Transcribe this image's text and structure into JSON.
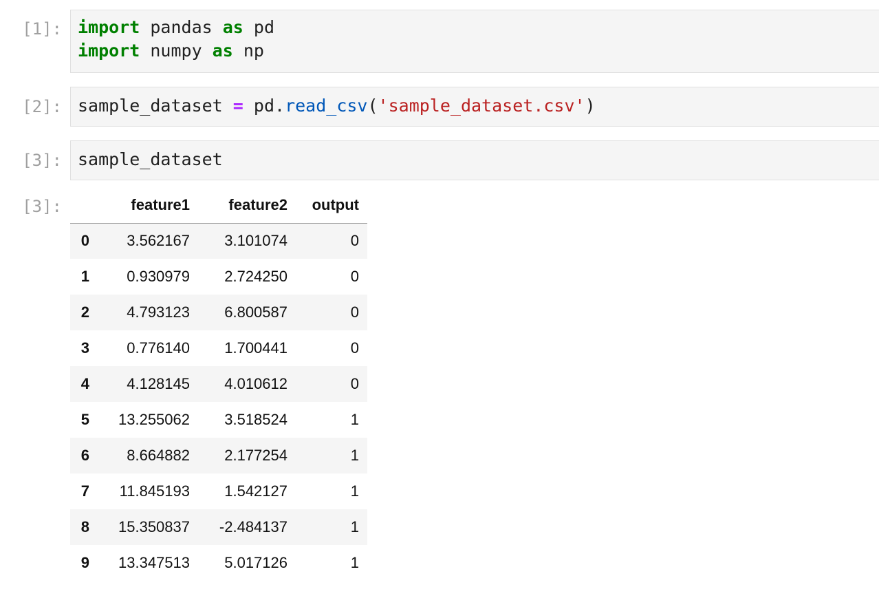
{
  "cells": [
    {
      "prompt": "[1]:",
      "lines": [
        [
          {
            "t": "import",
            "c": "kw"
          },
          {
            "t": " pandas ",
            "c": ""
          },
          {
            "t": "as",
            "c": "kw"
          },
          {
            "t": " pd",
            "c": ""
          }
        ],
        [
          {
            "t": "import",
            "c": "kw"
          },
          {
            "t": " numpy ",
            "c": ""
          },
          {
            "t": "as",
            "c": "kw"
          },
          {
            "t": " np",
            "c": ""
          }
        ]
      ]
    },
    {
      "prompt": "[2]:",
      "lines": [
        [
          {
            "t": "sample_dataset ",
            "c": ""
          },
          {
            "t": "=",
            "c": "op"
          },
          {
            "t": " pd.",
            "c": ""
          },
          {
            "t": "read_csv",
            "c": "fn"
          },
          {
            "t": "(",
            "c": ""
          },
          {
            "t": "'sample_dataset.csv'",
            "c": "str"
          },
          {
            "t": ")",
            "c": ""
          }
        ]
      ]
    },
    {
      "prompt": "[3]:",
      "lines": [
        [
          {
            "t": "sample_dataset",
            "c": ""
          }
        ]
      ]
    }
  ],
  "output": {
    "prompt": "[3]:",
    "columns": [
      "",
      "feature1",
      "feature2",
      "output"
    ],
    "rows": [
      [
        "0",
        "3.562167",
        "3.101074",
        "0"
      ],
      [
        "1",
        "0.930979",
        "2.724250",
        "0"
      ],
      [
        "2",
        "4.793123",
        "6.800587",
        "0"
      ],
      [
        "3",
        "0.776140",
        "1.700441",
        "0"
      ],
      [
        "4",
        "4.128145",
        "4.010612",
        "0"
      ],
      [
        "5",
        "13.255062",
        "3.518524",
        "1"
      ],
      [
        "6",
        "8.664882",
        "2.177254",
        "1"
      ],
      [
        "7",
        "11.845193",
        "1.542127",
        "1"
      ],
      [
        "8",
        "15.350837",
        "-2.484137",
        "1"
      ],
      [
        "9",
        "13.347513",
        "5.017126",
        "1"
      ]
    ]
  },
  "colors": {
    "keyword": "#008000",
    "operator": "#aa22ff",
    "function": "#0057b8",
    "string": "#ba2121",
    "prompt": "#a0a0a0"
  }
}
